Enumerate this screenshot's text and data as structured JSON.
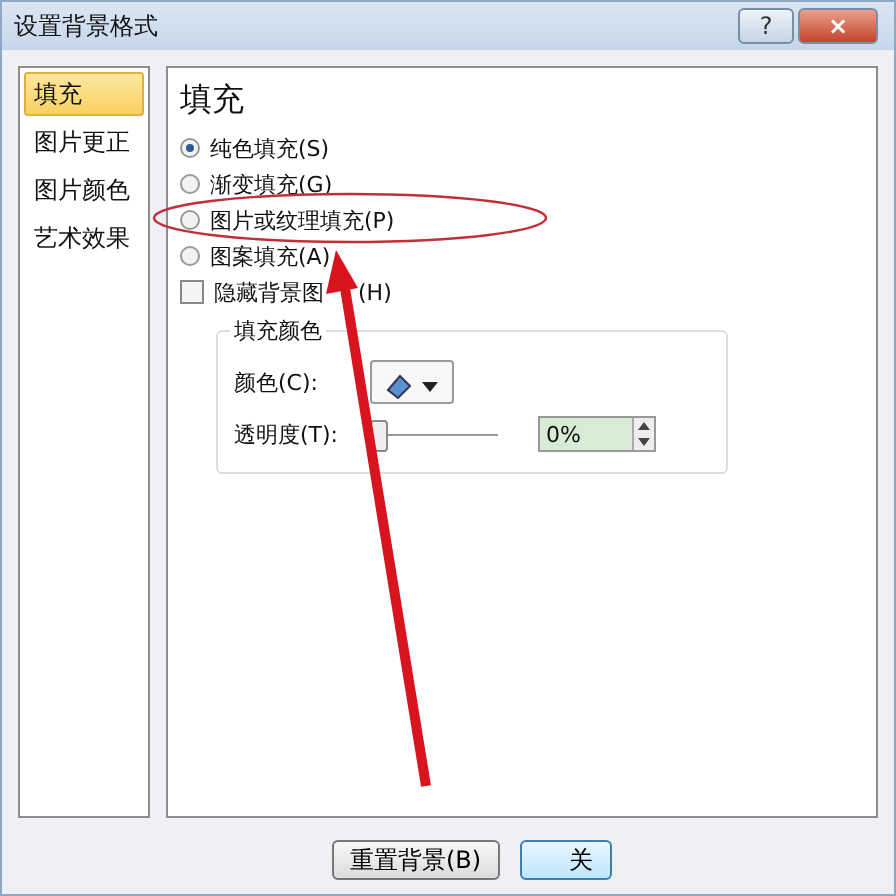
{
  "window": {
    "title": "设置背景格式",
    "help": "?",
    "close": "×"
  },
  "sidebar": {
    "items": [
      {
        "label": "填充",
        "selected": true
      },
      {
        "label": "图片更正",
        "selected": false
      },
      {
        "label": "图片颜色",
        "selected": false
      },
      {
        "label": "艺术效果",
        "selected": false
      }
    ]
  },
  "panel": {
    "heading": "填充",
    "options": [
      {
        "kind": "radio",
        "label": "纯色填充(S)",
        "selected": true
      },
      {
        "kind": "radio",
        "label": "渐变填充(G)",
        "selected": false
      },
      {
        "kind": "radio",
        "label": "图片或纹理填充(P)",
        "selected": false
      },
      {
        "kind": "radio",
        "label": "图案填充(A)",
        "selected": false
      },
      {
        "kind": "checkbox",
        "label": "隐藏背景图",
        "label_tail": "(H)",
        "checked": false
      }
    ],
    "fill_color": {
      "title": "填充颜色",
      "color_label": "颜色(C):",
      "transparency_label": "透明度(T):",
      "transparency": {
        "level": 0
      },
      "transparency_value": "0%"
    }
  },
  "buttons": [
    "重置背景(B)",
    "关"
  ]
}
